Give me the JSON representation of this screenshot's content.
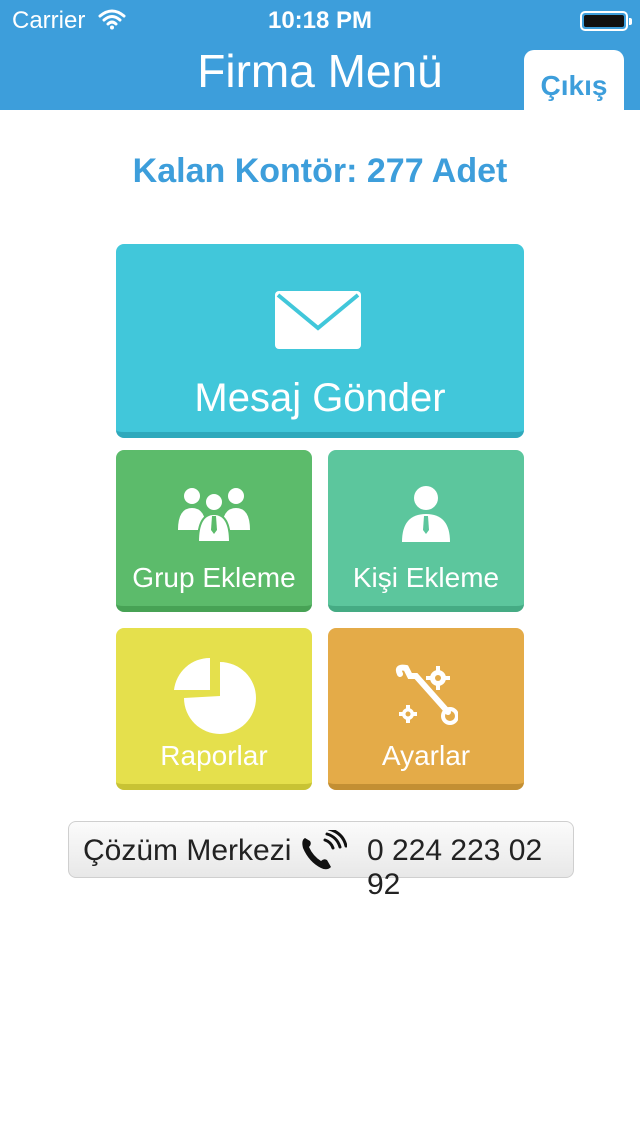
{
  "status_bar": {
    "carrier": "Carrier",
    "time": "10:18 PM"
  },
  "header": {
    "title": "Firma Menü",
    "logout_label": "Çıkış"
  },
  "credits": {
    "text": "Kalan Kontör: 277 Adet"
  },
  "tiles": {
    "send_message": {
      "label": "Mesaj Gönder",
      "icon": "mail-icon",
      "color": "#41c7da"
    },
    "add_group": {
      "label": "Grup Ekleme",
      "icon": "group-icon",
      "color": "#5cbb6b"
    },
    "add_person": {
      "label": "Kişi Ekleme",
      "icon": "person-icon",
      "color": "#5cc69d"
    },
    "reports": {
      "label": "Raporlar",
      "icon": "pie-chart-icon",
      "color": "#e5e04c"
    },
    "settings": {
      "label": "Ayarlar",
      "icon": "tools-icon",
      "color": "#e4ab48"
    }
  },
  "support": {
    "label": "Çözüm Merkezi",
    "icon": "phone-icon",
    "number": "0 224 223 02 92"
  },
  "colors": {
    "header": "#3d9edb",
    "accent": "#3d9edb"
  }
}
